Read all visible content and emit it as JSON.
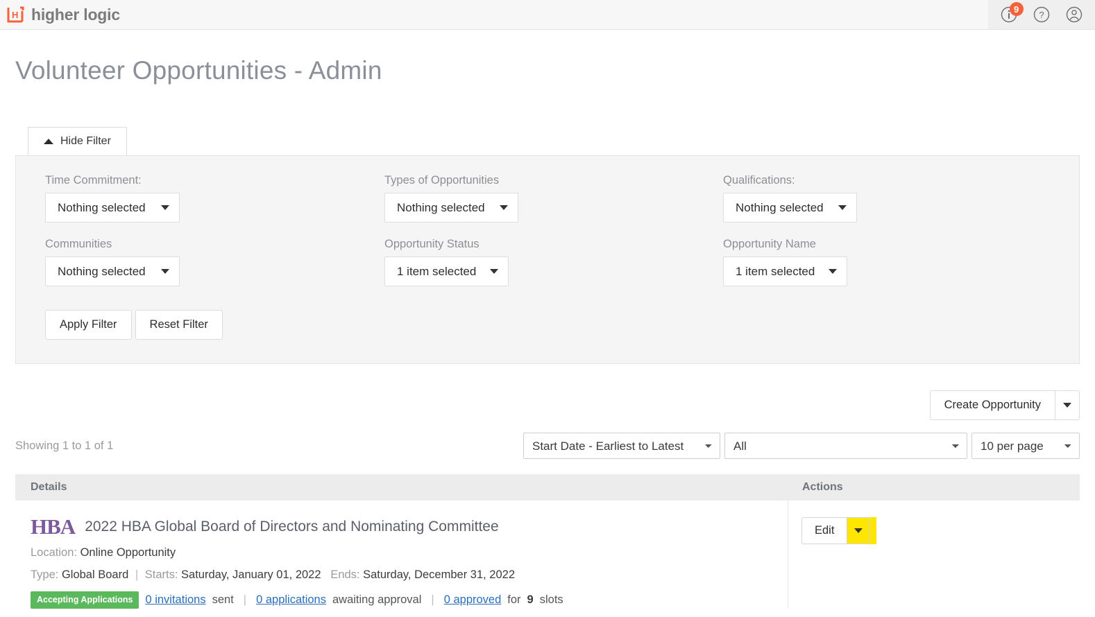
{
  "topbar": {
    "brand_name": "higher logic",
    "icons": [
      {
        "name": "info-icon",
        "badge": "9"
      },
      {
        "name": "help-icon",
        "badge": ""
      },
      {
        "name": "account-icon",
        "badge": ""
      }
    ]
  },
  "page": {
    "title": "Volunteer Opportunities - Admin"
  },
  "filter": {
    "toggle_label": "Hide Filter",
    "fields": [
      {
        "label": "Time Commitment:",
        "value": "Nothing selected"
      },
      {
        "label": "Types of Opportunities",
        "value": "Nothing selected"
      },
      {
        "label": "Qualifications:",
        "value": "Nothing selected"
      },
      {
        "label": "Communities",
        "value": "Nothing selected"
      },
      {
        "label": "Opportunity Status",
        "value": "1 item selected"
      },
      {
        "label": "Opportunity Name",
        "value": "1 item selected"
      }
    ],
    "apply_label": "Apply Filter",
    "reset_label": "Reset Filter"
  },
  "actions_bar": {
    "create_label": "Create Opportunity"
  },
  "toolbar": {
    "showing": "Showing 1 to 1 of 1",
    "sort_value": "Start Date - Earliest to Latest",
    "filter_value": "All",
    "page_size_value": "10 per page"
  },
  "table": {
    "headers": {
      "details": "Details",
      "actions": "Actions"
    },
    "rows": [
      {
        "logo_text": "HBA",
        "title": "2022 HBA Global Board of Directors and Nominating Committee",
        "location_label": "Location:",
        "location_value": "Online Opportunity",
        "type_label": "Type:",
        "type_value": "Global Board",
        "starts_label": "Starts:",
        "starts_value": "Saturday, January 01, 2022",
        "ends_label": "Ends:",
        "ends_value": "Saturday, December 31, 2022",
        "status_badge": "Accepting Applications",
        "invitations_link": "0 invitations",
        "invitations_suffix": "sent",
        "applications_link": "0 applications",
        "applications_suffix": "awaiting approval",
        "approved_link": "0 approved",
        "approved_prefix": "for",
        "slots_count": "9",
        "slots_suffix": "slots",
        "edit_label": "Edit"
      }
    ]
  },
  "colors": {
    "brand_orange": "#f4623a",
    "badge_green": "#5cb85c",
    "link_blue": "#2a6ebb",
    "highlight_yellow": "#ffe600",
    "hba_purple": "#7d5a9c"
  }
}
